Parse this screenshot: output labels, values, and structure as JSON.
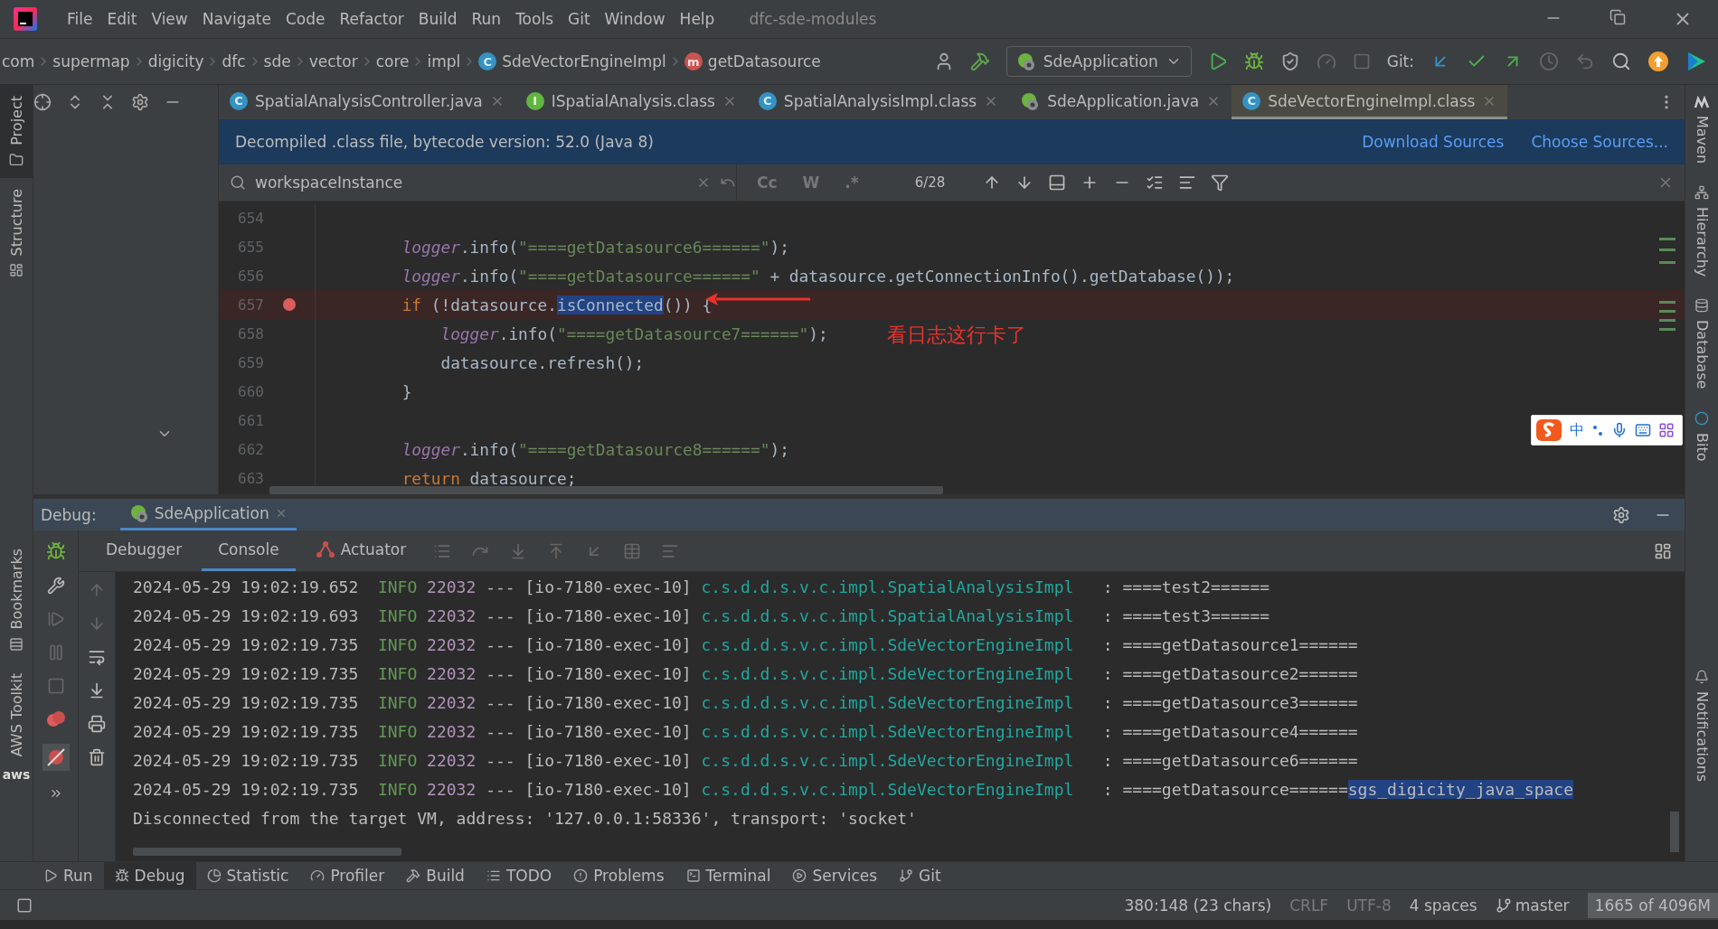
{
  "window": {
    "title": "dfc-sde-modules"
  },
  "menu": [
    "File",
    "Edit",
    "View",
    "Navigate",
    "Code",
    "Refactor",
    "Build",
    "Run",
    "Tools",
    "Git",
    "Window",
    "Help"
  ],
  "breadcrumbs": [
    {
      "label": "com",
      "kind": "package"
    },
    {
      "label": "supermap",
      "kind": "package"
    },
    {
      "label": "digicity",
      "kind": "package"
    },
    {
      "label": "dfc",
      "kind": "package"
    },
    {
      "label": "sde",
      "kind": "package"
    },
    {
      "label": "vector",
      "kind": "package"
    },
    {
      "label": "core",
      "kind": "package"
    },
    {
      "label": "impl",
      "kind": "package"
    },
    {
      "label": "SdeVectorEngineImpl",
      "kind": "class",
      "badge": "C"
    },
    {
      "label": "getDatasource",
      "kind": "method",
      "badge": "m"
    }
  ],
  "run_config": {
    "label": "SdeApplication"
  },
  "git": {
    "label": "Git:"
  },
  "left_strip": [
    {
      "label": "Project",
      "selected": true
    },
    {
      "label": "Structure",
      "selected": false
    }
  ],
  "left_strip_bottom": [
    {
      "label": "Bookmarks"
    },
    {
      "label": "AWS Toolkit"
    }
  ],
  "aws_logo": "aws",
  "right_strip": [
    {
      "label": "Maven",
      "kind": "maven"
    },
    {
      "label": "Hierarchy",
      "kind": "hierarchy"
    },
    {
      "label": "Database",
      "kind": "database"
    },
    {
      "label": "Bito",
      "kind": "bito"
    }
  ],
  "right_strip_bottom": {
    "label": "Notifications"
  },
  "tabs": [
    {
      "label": "SpatialAnalysisController.java",
      "kind": "class",
      "badge": "C",
      "selected": false
    },
    {
      "label": "ISpatialAnalysis.class",
      "kind": "interface",
      "badge": "I",
      "selected": false
    },
    {
      "label": "SpatialAnalysisImpl.class",
      "kind": "class",
      "badge": "C",
      "selected": false
    },
    {
      "label": "SdeApplication.java",
      "kind": "app",
      "selected": false
    },
    {
      "label": "SdeVectorEngineImpl.class",
      "kind": "class",
      "badge": "C",
      "selected": true
    }
  ],
  "banner": {
    "text": "Decompiled .class file, bytecode version: 52.0 (Java 8)",
    "links": [
      "Download Sources",
      "Choose Sources..."
    ]
  },
  "search": {
    "value": "workspaceInstance",
    "options": [
      "Cc",
      "W",
      ".*"
    ],
    "count": "6/28"
  },
  "code": [
    {
      "number": "654",
      "breakpoint": false
    },
    {
      "number": "655",
      "breakpoint": false,
      "tokens": [
        {
          "kind": "field",
          "text": "logger"
        },
        {
          "kind": "plain",
          "text": ".info("
        },
        {
          "kind": "string",
          "text": "\"====getDatasource6======\""
        },
        {
          "kind": "plain",
          "text": ");"
        }
      ]
    },
    {
      "number": "656",
      "breakpoint": false,
      "tokens": [
        {
          "kind": "field",
          "text": "logger"
        },
        {
          "kind": "plain",
          "text": ".info("
        },
        {
          "kind": "string",
          "text": "\"====getDatasource======\""
        },
        {
          "kind": "plain",
          "text": " + datasource.getConnectionInfo().getDatabase());"
        }
      ]
    },
    {
      "number": "657",
      "breakpoint": true,
      "tokens": [
        {
          "kind": "keyword",
          "text": "if"
        },
        {
          "kind": "plain",
          "text": " (!datasource."
        },
        {
          "kind": "match",
          "text": "isConnected"
        },
        {
          "kind": "plain",
          "text": "()) {"
        }
      ],
      "children": [
        {
          "number": "658",
          "breakpoint": false,
          "tokens": [
            {
              "kind": "field",
              "text": "logger"
            },
            {
              "kind": "plain",
              "text": ".info("
            },
            {
              "kind": "string",
              "text": "\"====getDatasource7======\""
            },
            {
              "kind": "plain",
              "text": ");"
            }
          ]
        },
        {
          "number": "659",
          "breakpoint": false,
          "tokens": [
            {
              "kind": "plain",
              "text": "datasource.refresh();"
            }
          ]
        }
      ]
    },
    {
      "number": "660",
      "breakpoint": false,
      "tokens": [
        {
          "kind": "plain",
          "text": "}"
        }
      ]
    },
    {
      "number": "661",
      "breakpoint": false
    },
    {
      "number": "662",
      "breakpoint": false,
      "tokens": [
        {
          "kind": "field",
          "text": "logger"
        },
        {
          "kind": "plain",
          "text": ".info("
        },
        {
          "kind": "string",
          "text": "\"====getDatasource8======\""
        },
        {
          "kind": "plain",
          "text": ");"
        }
      ]
    },
    {
      "number": "663",
      "breakpoint": false,
      "tokens": [
        {
          "kind": "keyword",
          "text": "return"
        },
        {
          "kind": "plain",
          "text": " datasource;"
        }
      ]
    }
  ],
  "annotation": {
    "text": "看日志这行卡了"
  },
  "ime_bar": {
    "label": "中"
  },
  "debug": {
    "label": "Debug:",
    "session": "SdeApplication",
    "tabs": [
      {
        "label": "Debugger",
        "selected": false
      },
      {
        "label": "Console",
        "selected": true
      },
      {
        "label": "Actuator",
        "selected": false
      }
    ]
  },
  "console": [
    {
      "kind": "log",
      "time": "2024-05-29 19:02:19.652",
      "level": "INFO",
      "pid": "22032",
      "sep": "---",
      "thread": "[io-7180-exec-10]",
      "logger": "c.s.d.d.s.v.c.impl.SpatialAnalysisImpl",
      "colon": ":",
      "message": "====test2======"
    },
    {
      "kind": "log",
      "time": "2024-05-29 19:02:19.693",
      "level": "INFO",
      "pid": "22032",
      "sep": "---",
      "thread": "[io-7180-exec-10]",
      "logger": "c.s.d.d.s.v.c.impl.SpatialAnalysisImpl",
      "colon": ":",
      "message": "====test3======"
    },
    {
      "kind": "log",
      "time": "2024-05-29 19:02:19.735",
      "level": "INFO",
      "pid": "22032",
      "sep": "---",
      "thread": "[io-7180-exec-10]",
      "logger": "c.s.d.d.s.v.c.impl.SdeVectorEngineImpl",
      "colon": ":",
      "message": "====getDatasource1======"
    },
    {
      "kind": "log",
      "time": "2024-05-29 19:02:19.735",
      "level": "INFO",
      "pid": "22032",
      "sep": "---",
      "thread": "[io-7180-exec-10]",
      "logger": "c.s.d.d.s.v.c.impl.SdeVectorEngineImpl",
      "colon": ":",
      "message": "====getDatasource2======"
    },
    {
      "kind": "log",
      "time": "2024-05-29 19:02:19.735",
      "level": "INFO",
      "pid": "22032",
      "sep": "---",
      "thread": "[io-7180-exec-10]",
      "logger": "c.s.d.d.s.v.c.impl.SdeVectorEngineImpl",
      "colon": ":",
      "message": "====getDatasource3======"
    },
    {
      "kind": "log",
      "time": "2024-05-29 19:02:19.735",
      "level": "INFO",
      "pid": "22032",
      "sep": "---",
      "thread": "[io-7180-exec-10]",
      "logger": "c.s.d.d.s.v.c.impl.SdeVectorEngineImpl",
      "colon": ":",
      "message": "====getDatasource4======"
    },
    {
      "kind": "log",
      "time": "2024-05-29 19:02:19.735",
      "level": "INFO",
      "pid": "22032",
      "sep": "---",
      "thread": "[io-7180-exec-10]",
      "logger": "c.s.d.d.s.v.c.impl.SdeVectorEngineImpl",
      "colon": ":",
      "message": "====getDatasource6======"
    },
    {
      "kind": "log",
      "time": "2024-05-29 19:02:19.735",
      "level": "INFO",
      "pid": "22032",
      "sep": "---",
      "thread": "[io-7180-exec-10]",
      "logger": "c.s.d.d.s.v.c.impl.SdeVectorEngineImpl",
      "colon": ":",
      "message": "====getDatasource======",
      "selection": "sgs_digicity_java_space"
    },
    {
      "kind": "plain",
      "text": "Disconnected from the target VM, address: '127.0.0.1:58336', transport: 'socket'"
    }
  ],
  "tool_windows": [
    {
      "label": "Run",
      "kind": "run",
      "selected": false
    },
    {
      "label": "Debug",
      "kind": "debug",
      "selected": true
    },
    {
      "label": "Statistic",
      "kind": "statistic",
      "selected": false
    },
    {
      "label": "Profiler",
      "kind": "profiler",
      "selected": false
    },
    {
      "label": "Build",
      "kind": "build",
      "selected": false
    },
    {
      "label": "TODO",
      "kind": "todo",
      "selected": false
    },
    {
      "label": "Problems",
      "kind": "problems",
      "selected": false
    },
    {
      "label": "Terminal",
      "kind": "terminal",
      "selected": false
    },
    {
      "label": "Services",
      "kind": "services",
      "selected": false
    },
    {
      "label": "Git",
      "kind": "git",
      "selected": false
    }
  ],
  "status_bar": {
    "position": "380:148 (23 chars)",
    "line_separator": "CRLF",
    "encoding": "UTF-8",
    "indent": "4 spaces",
    "branch": "master",
    "memory": "1665 of 4096M"
  }
}
